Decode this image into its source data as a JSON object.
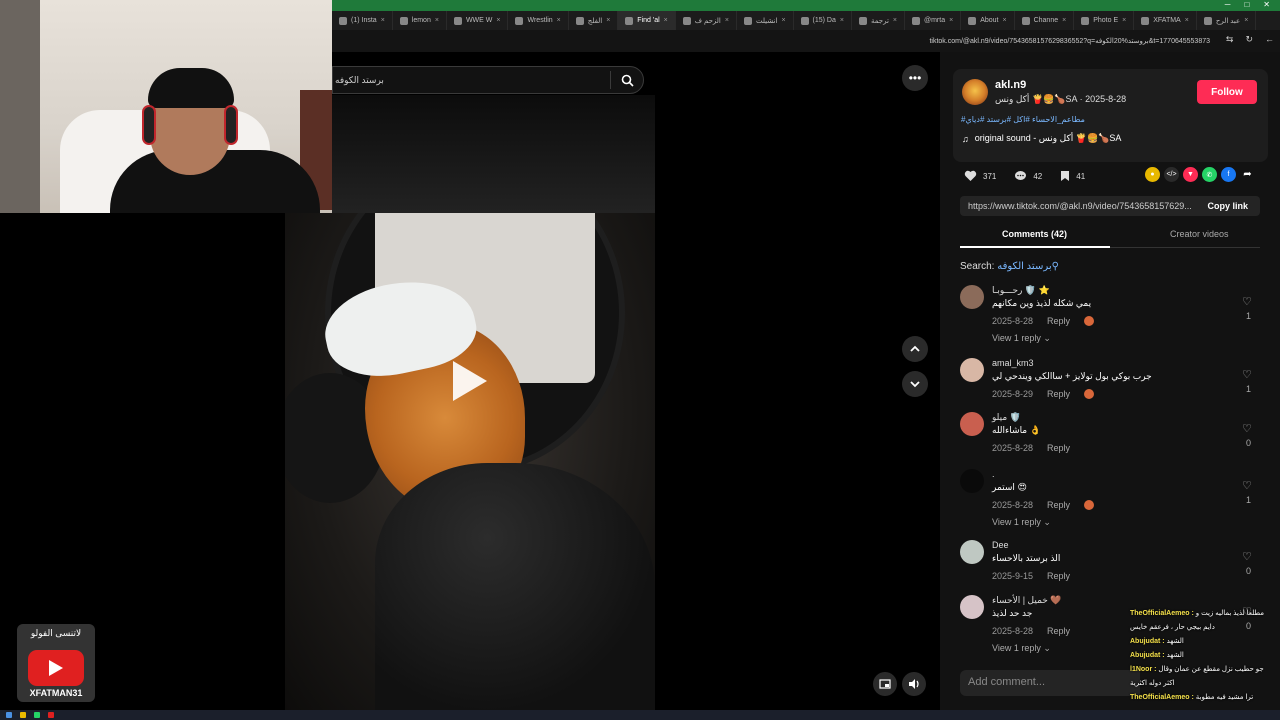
{
  "browser": {
    "tabs": [
      {
        "label": "(1) Insta",
        "active": false
      },
      {
        "label": "lemon",
        "active": false
      },
      {
        "label": "WWE W",
        "active": false
      },
      {
        "label": "Wrestlin",
        "active": false
      },
      {
        "label": "الفلج",
        "active": false
      },
      {
        "label": "Find 'al",
        "active": true
      },
      {
        "label": "الزحم ف",
        "active": false
      },
      {
        "label": "انشيلت",
        "active": false
      },
      {
        "label": "(15) Da",
        "active": false
      },
      {
        "label": "ترجمة",
        "active": false
      },
      {
        "label": "@mrta",
        "active": false
      },
      {
        "label": "About",
        "active": false
      },
      {
        "label": "Channe",
        "active": false
      },
      {
        "label": "Photo E",
        "active": false
      },
      {
        "label": "XFATMA",
        "active": false
      },
      {
        "label": "عبد الرح",
        "active": false
      }
    ],
    "url": "tiktok.com/@akl.n9/video/7543658157629836552?q=بروستد%20الكوفه&t=1770645553873"
  },
  "search": {
    "value": "برستد الكوفه"
  },
  "yt_overlay": {
    "top_text": "لاتنسى الفولو",
    "channel": "XFATMAN31"
  },
  "author": {
    "name": "akl.n9",
    "subtitle": "أكل ونس 🍟🍔🍗SA · 2025-8-28",
    "follow_label": "Follow",
    "hashtags": "#مطاعم_الاحساء #اكل #برستد #دياي",
    "sound": "original sound - أكل ونس 🍟🍔🍗SA"
  },
  "stats": {
    "likes": "371",
    "comments": "42",
    "saves": "41"
  },
  "share": {
    "url": "https://www.tiktok.com/@akl.n9/video/7543658157629...",
    "copy_label": "Copy link"
  },
  "panel_tabs": {
    "comments": "Comments (42)",
    "creator": "Creator videos"
  },
  "search_line": {
    "prefix": "Search:",
    "query": "برستد الكوفه"
  },
  "comments": [
    {
      "name": "رحـــوبـا 🛡️ ⭐",
      "text": "يمي شكله لذيذ وين مكانهم",
      "date": "2025-8-28",
      "reply": "Reply",
      "likes": "1",
      "view_replies": "View 1 reply ⌄"
    },
    {
      "name": "amal_km3",
      "text": "جرب بوكي بول تولايز + ساالكي ويندحي لي",
      "date": "2025-8-29",
      "reply": "Reply",
      "likes": "1",
      "view_replies": ""
    },
    {
      "name": "ميلو 🛡️",
      "text": "ماشاءالله 👌",
      "date": "2025-8-28",
      "reply": "Reply",
      "likes": "0",
      "view_replies": ""
    },
    {
      "name": ".",
      "text": "استمر 😍",
      "date": "2025-8-28",
      "reply": "Reply",
      "likes": "1",
      "view_replies": "View 1 reply ⌄"
    },
    {
      "name": "Dee",
      "text": "الذ برستد بالاحساء",
      "date": "2025-9-15",
      "reply": "Reply",
      "likes": "0",
      "view_replies": ""
    },
    {
      "name": "خميل | الأحساء 🤎",
      "text": "جد حد لذيذ",
      "date": "2025-8-28",
      "reply": "Reply",
      "likes": "0",
      "view_replies": "View 1 reply ⌄"
    }
  ],
  "add_comment": {
    "placeholder": "Add comment..."
  },
  "chat": [
    {
      "name": "TheOfficialAemeo :",
      "text": "مطلعا لذيذ بماليه زيت و"
    },
    {
      "name": "",
      "text": "دايم بيجي حار ، فرعقم خايس"
    },
    {
      "name": "Abujudat :",
      "text": "الشهد"
    },
    {
      "name": "Abujudat :",
      "text": "الشهد"
    },
    {
      "name": "l1Noor :",
      "text": "جو حطيب نزل مقطع عن عمان وقال"
    },
    {
      "name": "",
      "text": "اكثر دوله اكثرية"
    },
    {
      "name": "TheOfficialAemeo :",
      "text": "ترا مشيد فيه مطوبة"
    }
  ],
  "colors": {
    "follow": "#fe2c55",
    "hashtag": "#7ab8ff",
    "panel_bg": "#121212"
  }
}
